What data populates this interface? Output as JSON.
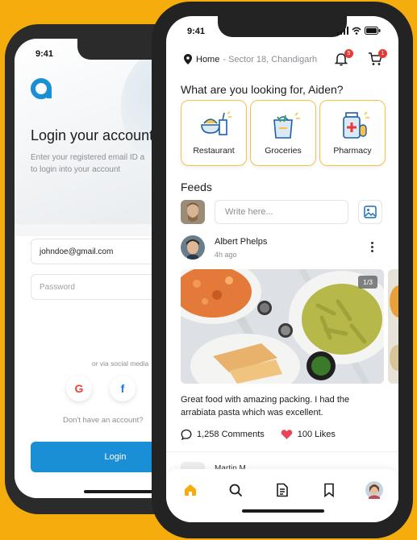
{
  "colors": {
    "background": "#f5ad0e",
    "accent": "#f5ad0e",
    "login_button": "#1a8fd6",
    "badge": "#e53935"
  },
  "login_screen": {
    "time": "9:41",
    "title": "Login your account",
    "subtitle_line1": "Enter your registered email ID a",
    "subtitle_line2": "to login into your account",
    "email_value": "johndoe@gmail.com",
    "password_placeholder": "Password",
    "via_social": "or via social media",
    "google_label": "G",
    "facebook_label": "f",
    "no_account": "Don't have an account?",
    "login_button": "Login"
  },
  "feed_screen": {
    "time": "9:41",
    "location_label": "Home",
    "location_detail": "- Sector 18, Chandigarh",
    "notifications_count": "5",
    "cart_count": "1",
    "question": "What are you looking for, Aiden?",
    "categories": [
      {
        "label": "Restaurant",
        "icon": "restaurant-icon"
      },
      {
        "label": "Groceries",
        "icon": "groceries-icon"
      },
      {
        "label": "Pharmacy",
        "icon": "pharmacy-icon"
      }
    ],
    "feeds_title": "Feeds",
    "write_placeholder": "Write here...",
    "post": {
      "author": "Albert Phelps",
      "time_ago": "4h ago",
      "image_counter": "1/3",
      "caption": "Great food with amazing packing. I had the arrabiata pasta which was excellent.",
      "comments": "1,258 Comments",
      "likes": "100 Likes"
    },
    "next_post_author": "Martin M",
    "tabs": [
      "home-icon",
      "search-icon",
      "orders-icon",
      "bookmark-icon",
      "profile-avatar"
    ]
  }
}
